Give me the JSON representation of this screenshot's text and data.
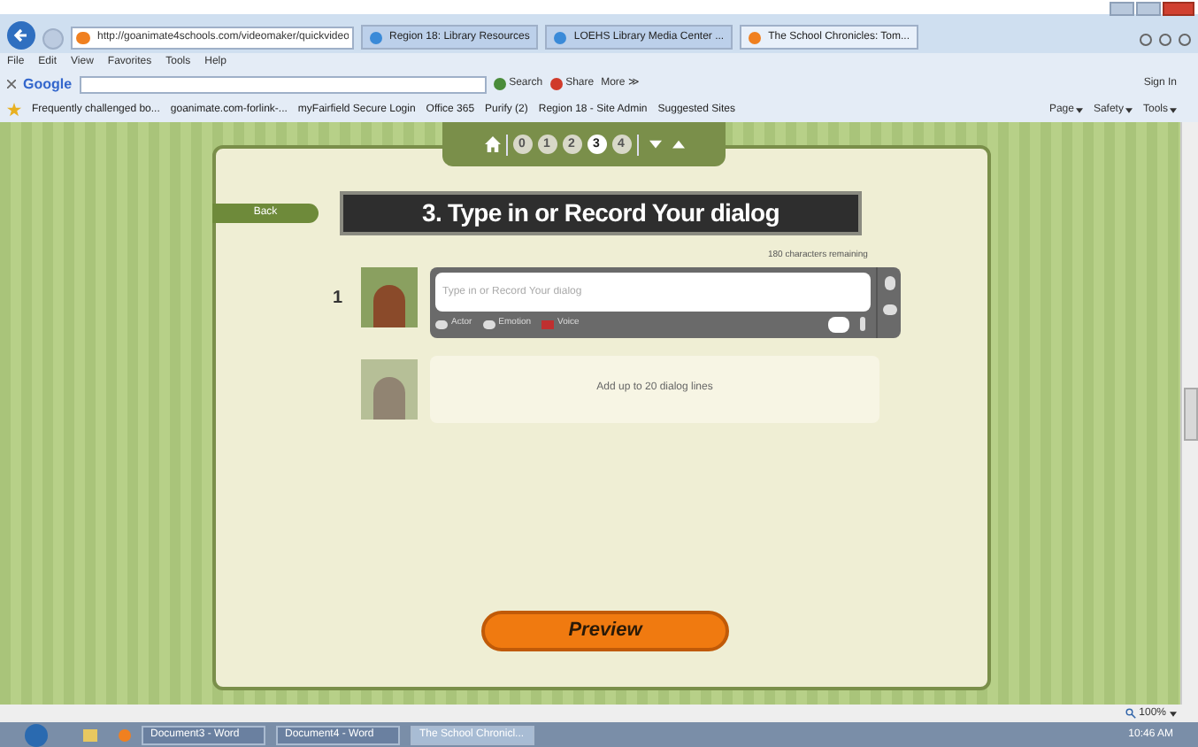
{
  "browser": {
    "url": "http://goanimate4schools.com/videomaker/quickvideo",
    "tabs": [
      {
        "label": "Region 18: Library Resources",
        "selected": false
      },
      {
        "label": "LOEHS Library Media Center ...",
        "selected": false
      },
      {
        "label": "The School Chronicles: Tom...",
        "selected": true
      }
    ],
    "menu": [
      "File",
      "Edit",
      "View",
      "Favorites",
      "Tools",
      "Help"
    ],
    "google": {
      "label": "Google",
      "search": "Search",
      "share": "Share",
      "more": "More ≫",
      "sign_in": "Sign In"
    },
    "favorites": [
      "Frequently challenged bo...",
      "goanimate.com-forlink-...",
      "myFairfield Secure Login",
      "Office 365",
      "Purify (2)",
      "Region 18 - Site Admin",
      "Suggested Sites"
    ],
    "commands": [
      "Page",
      "Safety",
      "Tools"
    ]
  },
  "app": {
    "steps": [
      {
        "label": "0",
        "selected": false
      },
      {
        "label": "1",
        "selected": false
      },
      {
        "label": "2",
        "selected": false
      },
      {
        "label": "3",
        "selected": true
      },
      {
        "label": "4",
        "selected": false
      }
    ],
    "back": "Back",
    "title": "3. Type in or Record Your dialog",
    "chars_remaining": "180 characters remaining",
    "lines": [
      {
        "number": "1",
        "placeholder": "Type in or Record Your dialog",
        "tools": [
          "Actor",
          "Emotion",
          "Voice"
        ]
      }
    ],
    "add_hint": "Add up to 20 dialog lines",
    "preview": "Preview"
  },
  "status": {
    "zoom": "100%"
  },
  "taskbar": {
    "items": [
      {
        "label": "Document3 - Word",
        "selected": false
      },
      {
        "label": "Document4 - Word",
        "selected": false
      },
      {
        "label": "The School Chronicl...",
        "selected": true
      }
    ],
    "clock": "10:46 AM"
  }
}
